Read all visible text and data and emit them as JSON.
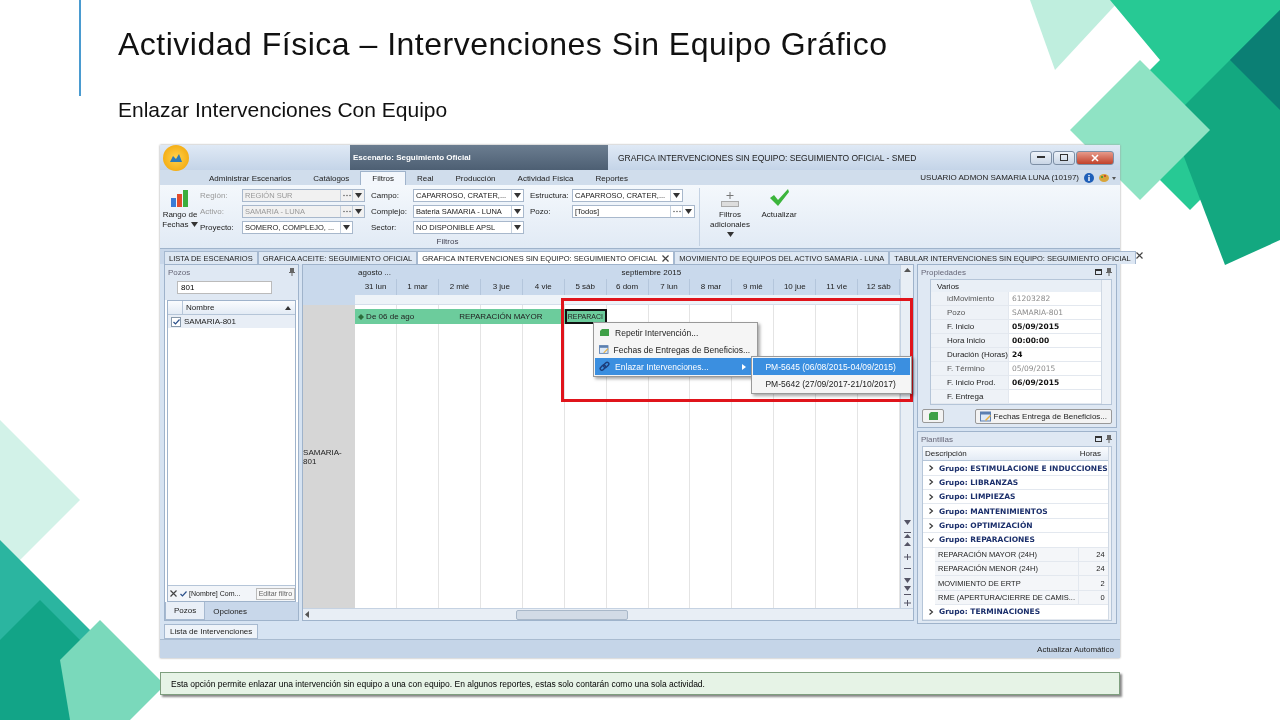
{
  "slide": {
    "title": "Actividad Física – Intervenciones Sin Equipo Gráfico",
    "subtitle": "Enlazar Intervenciones Con Equipo",
    "caption": "Esta opción permite enlazar una intervención sin equipo a una con equipo. En algunos reportes, estas solo contarán como una sola actividad."
  },
  "window": {
    "scenario": "Escenario: Seguimiento Oficial",
    "title": "GRAFICA INTERVENCIONES SIN EQUIPO: SEGUIMIENTO OFICIAL - SMED",
    "user": "USUARIO ADMON SAMARIA LUNA (10197)"
  },
  "menu_tabs": [
    {
      "label": "Administrar Escenarios",
      "selected": false
    },
    {
      "label": "Catálogos",
      "selected": false
    },
    {
      "label": "Filtros",
      "selected": true
    },
    {
      "label": "Real",
      "selected": false
    },
    {
      "label": "Producción",
      "selected": false
    },
    {
      "label": "Actividad Física",
      "selected": false
    },
    {
      "label": "Reportes",
      "selected": false
    }
  ],
  "ribbon": {
    "date_button": "Rango de Fechas",
    "group_label": "Filtros",
    "extra_button": "Filtros adicionales",
    "refresh_button": "Actualizar",
    "filter_columns": [
      [
        {
          "label": "Región:",
          "value": "REGIÓN SUR",
          "disabled": true,
          "more": true
        },
        {
          "label": "Activo:",
          "value": "SAMARIA - LUNA",
          "disabled": true,
          "more": true
        },
        {
          "label": "Proyecto:",
          "value": "SOMERO, COMPLEJO, ...",
          "disabled": false,
          "more": false
        }
      ],
      [
        {
          "label": "Campo:",
          "value": "CAPARROSO, CRATER,...",
          "disabled": false,
          "more": false
        },
        {
          "label": "Complejo:",
          "value": "Bateria SAMARIA - LUNA",
          "disabled": false,
          "more": false
        },
        {
          "label": "Sector:",
          "value": "NO DISPONIBLE APSL",
          "disabled": false,
          "more": false
        }
      ],
      [
        {
          "label": "Estructura:",
          "value": "CAPARROSO, CRATER,...",
          "disabled": false,
          "more": false
        },
        {
          "label": "Pozo:",
          "value": "[Todos]",
          "disabled": false,
          "more": true
        }
      ]
    ]
  },
  "doc_tabs": [
    {
      "label": "LISTA DE ESCENARIOS",
      "selected": false
    },
    {
      "label": "GRAFICA ACEITE: SEGUIMIENTO OFICIAL",
      "selected": false
    },
    {
      "label": "GRAFICA INTERVENCIONES SIN EQUIPO: SEGUIMIENTO OFICIAL",
      "selected": true
    },
    {
      "label": "MOVIMIENTO DE EQUIPOS DEL ACTIVO SAMARIA - LUNA",
      "selected": false
    },
    {
      "label": "TABULAR INTERVENCIONES SIN EQUIPO: SEGUIMIENTO OFICIAL",
      "selected": false
    }
  ],
  "pozos_panel": {
    "title": "Pozos",
    "search": "801",
    "column": "Nombre",
    "rows": [
      {
        "name": "SAMARIA-801",
        "checked": true
      }
    ],
    "filter_enabled": true,
    "filter_text": "[Nombre] Com...",
    "filter_button": "Editar filtro",
    "tabs": [
      {
        "label": "Pozos",
        "selected": true
      },
      {
        "label": "Opciones",
        "selected": false
      }
    ]
  },
  "gantt": {
    "months": [
      {
        "label": "agosto ...",
        "days": [
          "31 lun"
        ]
      },
      {
        "label": "septiembre 2015",
        "days": [
          "1 mar",
          "2 mié",
          "3 jue",
          "4 vie",
          "5 sáb",
          "6 dom",
          "7 lun",
          "8 mar",
          "9 mié",
          "10 jue",
          "11 vie",
          "12 sáb"
        ]
      }
    ],
    "row_label": "SAMARIA-801",
    "bar": {
      "start": "De 06 de ago",
      "label": "REPARACIÓN MAYOR"
    },
    "selected_cell": "REPARACI",
    "menu": [
      {
        "label": "Repetir Intervención...",
        "kind": "repeat",
        "selected": false,
        "submenu": false
      },
      {
        "label": "Fechas de Entregas de Beneficios...",
        "kind": "calendar",
        "selected": false,
        "submenu": false
      },
      {
        "label": "Enlazar Intervenciones...",
        "kind": "link",
        "selected": true,
        "submenu": true
      }
    ],
    "submenu": [
      {
        "label": "PM-5645 (06/08/2015-04/09/2015)",
        "selected": true
      },
      {
        "label": "PM-5642 (27/09/2017-21/10/2017)",
        "selected": false
      }
    ]
  },
  "properties": {
    "title": "Propiedades",
    "category": "Varios",
    "button": "Fechas Entrega de Beneficios...",
    "rows": [
      {
        "name": "idMovimiento",
        "value": "61203282",
        "readonly": true
      },
      {
        "name": "Pozo",
        "value": "SAMARIA-801",
        "readonly": true
      },
      {
        "name": "F. Inicio",
        "value": "05/09/2015",
        "readonly": false
      },
      {
        "name": "Hora Inicio",
        "value": "00:00:00",
        "readonly": false
      },
      {
        "name": "Duración (Horas)",
        "value": "24",
        "readonly": false
      },
      {
        "name": "F. Término",
        "value": "05/09/2015",
        "readonly": true
      },
      {
        "name": "F. Inicio Prod.",
        "value": "06/09/2015",
        "readonly": false
      },
      {
        "name": "F. Entrega",
        "readonly": false
      }
    ]
  },
  "templates": {
    "title": "Plantillas",
    "columns": [
      "Descripción",
      "Horas"
    ],
    "groups": [
      {
        "label": "Grupo: ESTIMULACIONE E INDUCCIONES",
        "expanded": false
      },
      {
        "label": "Grupo: LIBRANZAS",
        "expanded": false
      },
      {
        "label": "Grupo: LIMPIEZAS",
        "expanded": false
      },
      {
        "label": "Grupo: MANTENIMIENTOS",
        "expanded": false
      },
      {
        "label": "Grupo: OPTIMIZACIÓN",
        "expanded": false
      },
      {
        "label": "Grupo: REPARACIONES",
        "expanded": true,
        "children": [
          {
            "label": "REPARACIÓN MAYOR (24H)",
            "hours": "24"
          },
          {
            "label": "REPARACIÓN MENOR (24H)",
            "hours": "24"
          },
          {
            "label": "MOVIMIENTO DE ERTP",
            "hours": "2"
          },
          {
            "label": "RME (APERTURA/CIERRE DE CAMIS...",
            "hours": "0"
          }
        ]
      },
      {
        "label": "Grupo: TERMINACIONES",
        "expanded": false
      }
    ]
  },
  "bottom_tab": "Lista de Intervenciones",
  "status": "Actualizar Automático"
}
